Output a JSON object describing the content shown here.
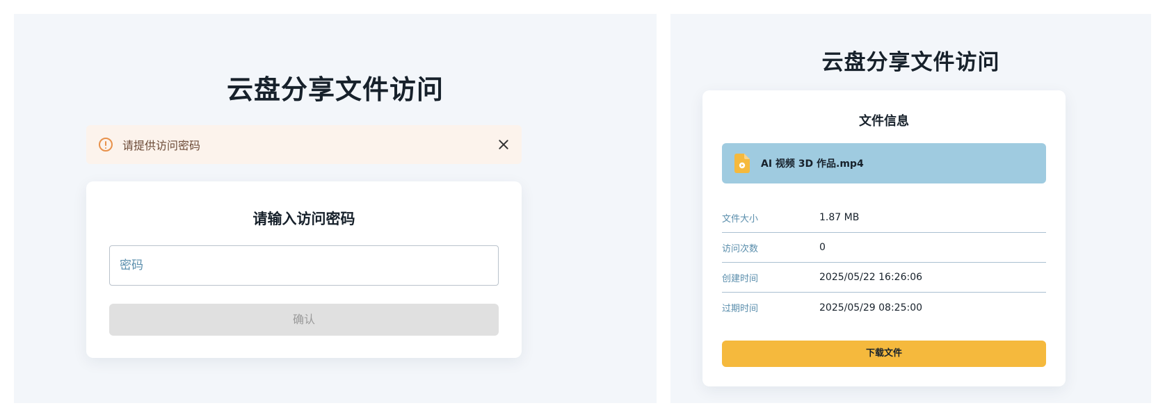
{
  "colors": {
    "panel_bg": "#f3f6fa",
    "alert_bg": "#fcf3ec",
    "alert_icon": "#e8914a",
    "file_bar_bg": "#9fcbe0",
    "download_button": "#f5b93d",
    "label_text": "#5a8eac",
    "disabled_button": "#e0e0e0"
  },
  "left": {
    "title": "云盘分享文件访问",
    "alert": {
      "icon": "alert-circle-icon",
      "message": "请提供访问密码",
      "close_icon": "close-icon"
    },
    "password_card": {
      "title": "请输入访问密码",
      "input_placeholder": "密码",
      "input_value": "",
      "confirm_label": "确认"
    }
  },
  "right": {
    "title": "云盘分享文件访问",
    "file_card": {
      "title": "文件信息",
      "file_icon": "file-icon",
      "file_name": "AI 视频 3D 作品.mp4",
      "rows": [
        {
          "label": "文件大小",
          "value": "1.87 MB"
        },
        {
          "label": "访问次数",
          "value": "0"
        },
        {
          "label": "创建时间",
          "value": "2025/05/22 16:26:06"
        },
        {
          "label": "过期时间",
          "value": "2025/05/29 08:25:00"
        }
      ],
      "download_label": "下载文件"
    }
  }
}
